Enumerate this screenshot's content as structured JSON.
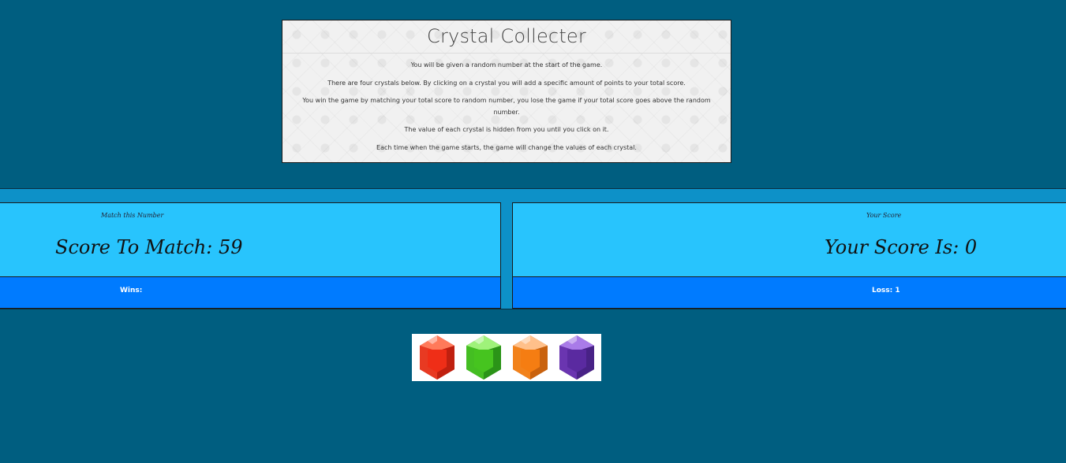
{
  "intro": {
    "title": "Crystal Collecter",
    "paragraphs": [
      "You will be given a random number at the start of the game.",
      "There are four crystals below. By clicking on a crystal you will add a specific amount of points to your total score.",
      "You win the game by matching your total score to random number, you lose the game if your total score goes above the random number.",
      "The value of each crystal is hidden from you until you click on it.",
      "Each time when the game starts, the game will change the values of each crystal."
    ]
  },
  "match_panel": {
    "label": "Match this Number",
    "value_text": "Score To Match: 59"
  },
  "score_panel": {
    "label": "Your Score",
    "value_text": "Your Score Is: 0"
  },
  "tally": {
    "wins_text": "Wins:",
    "loss_text": "Loss: 1"
  },
  "crystals": [
    {
      "icon": "red-crystal-icon",
      "color": "#e0301e"
    },
    {
      "icon": "green-crystal-icon",
      "color": "#3fb51f"
    },
    {
      "icon": "orange-crystal-icon",
      "color": "#f07a16"
    },
    {
      "icon": "purple-crystal-icon",
      "color": "#6a35b0"
    }
  ],
  "colors": {
    "page_background": "#005e80",
    "band_background": "#0d91c8",
    "score_panel": "#28c4fd",
    "tally_bar": "#007bff"
  }
}
